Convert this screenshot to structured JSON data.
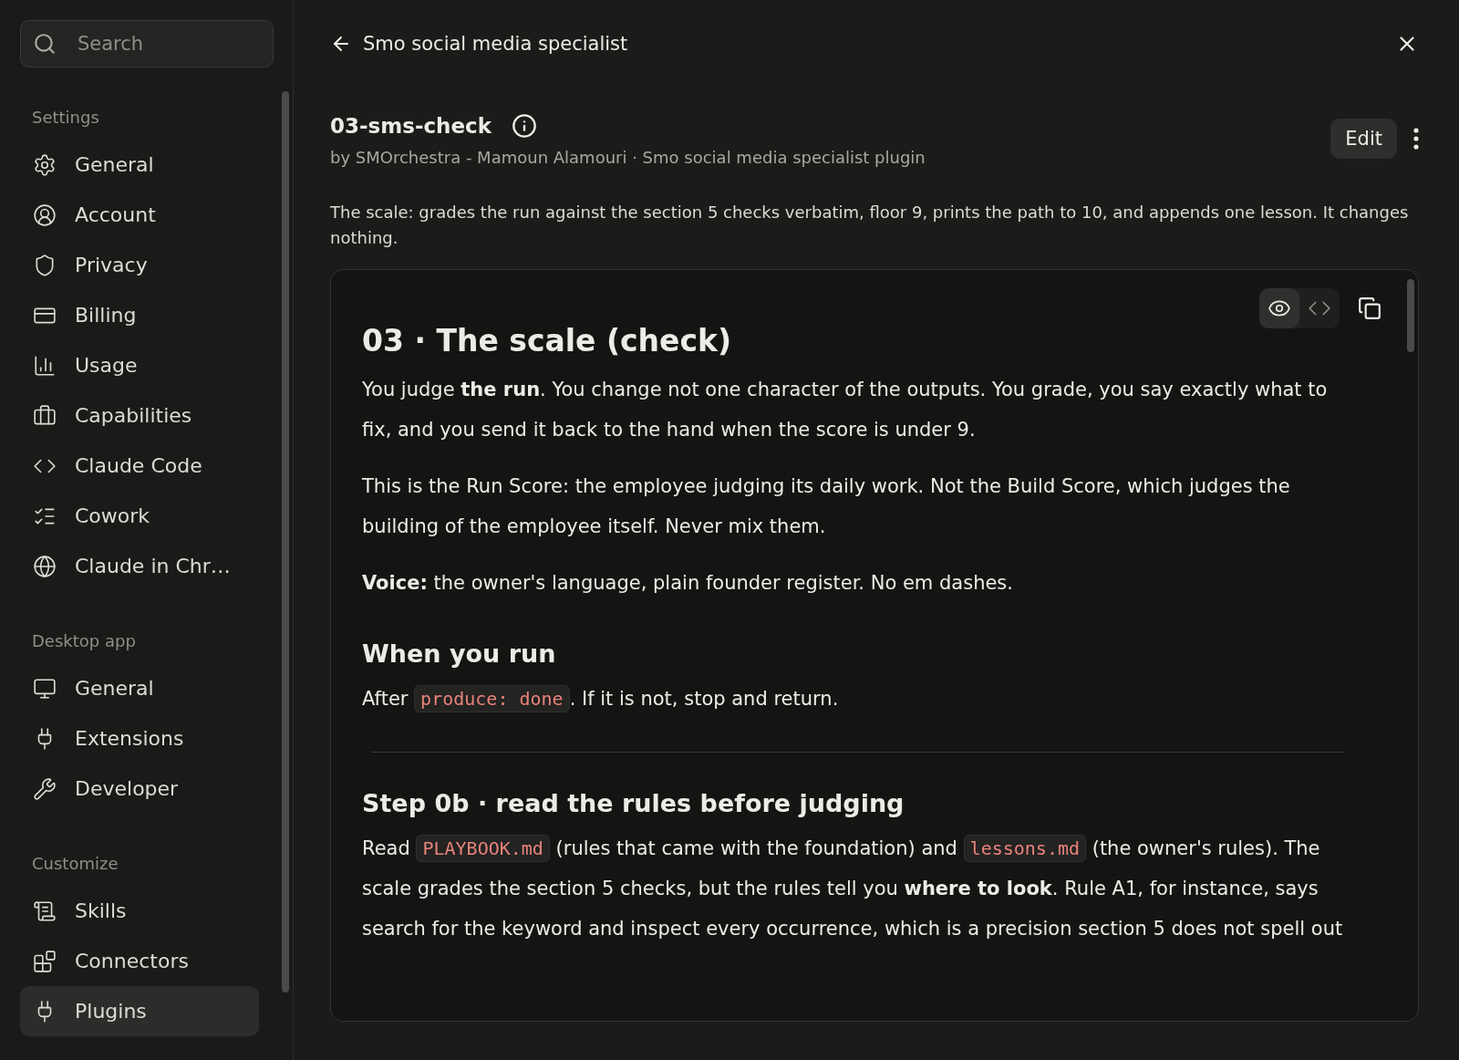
{
  "sidebar": {
    "search": {
      "placeholder": "Search"
    },
    "sections": [
      {
        "title": "Settings",
        "items": [
          {
            "label": "General",
            "selected": false
          },
          {
            "label": "Account",
            "selected": false
          },
          {
            "label": "Privacy",
            "selected": false
          },
          {
            "label": "Billing",
            "selected": false
          },
          {
            "label": "Usage",
            "selected": false
          },
          {
            "label": "Capabilities",
            "selected": false
          },
          {
            "label": "Claude Code",
            "selected": false
          },
          {
            "label": "Cowork",
            "selected": false
          },
          {
            "label": "Claude in Chr…",
            "selected": false
          }
        ]
      },
      {
        "title": "Desktop app",
        "items": [
          {
            "label": "General",
            "selected": false
          },
          {
            "label": "Extensions",
            "selected": false
          },
          {
            "label": "Developer",
            "selected": false
          }
        ]
      },
      {
        "title": "Customize",
        "items": [
          {
            "label": "Skills",
            "selected": false
          },
          {
            "label": "Connectors",
            "selected": false
          },
          {
            "label": "Plugins",
            "selected": true
          }
        ]
      }
    ]
  },
  "header": {
    "title": "Smo social media specialist"
  },
  "skill": {
    "name": "03-sms-check",
    "byline": "by SMOrchestra - Mamoun Alamouri · Smo social media specialist plugin",
    "edit_label": "Edit",
    "description": "The scale: grades the run against the section 5 checks verbatim, floor 9, prints the path to 10, and appends one lesson. It changes nothing."
  },
  "viewer": {
    "modes": [
      {
        "kind": "preview",
        "selected": true
      },
      {
        "kind": "code",
        "selected": false
      }
    ],
    "blocks": [
      {
        "kind": "h1",
        "parts": [
          {
            "kind": "text",
            "text": "03 · The scale (check)"
          }
        ]
      },
      {
        "kind": "p",
        "parts": [
          {
            "kind": "text",
            "text": "You judge **the run**. You change not one character of the outputs. You grade, you say exactly what to fix, and you send it back to the hand when the score is under 9."
          }
        ]
      },
      {
        "kind": "p",
        "parts": [
          {
            "kind": "text",
            "text": "This is the Run Score: the employee judging its daily work. Not the Build Score, which judges the building of the employee itself. Never mix them."
          }
        ]
      },
      {
        "kind": "p",
        "parts": [
          {
            "kind": "text",
            "text": "**Voice:** the owner's language, plain founder register. No em dashes."
          }
        ]
      },
      {
        "kind": "h2",
        "parts": [
          {
            "kind": "text",
            "text": "When you run"
          }
        ]
      },
      {
        "kind": "p",
        "parts": [
          {
            "kind": "text",
            "text": "After "
          },
          {
            "kind": "code",
            "text": "produce: done"
          },
          {
            "kind": "text",
            "text": ". If it is not, stop and return."
          }
        ]
      },
      {
        "kind": "hr"
      },
      {
        "kind": "h2",
        "parts": [
          {
            "kind": "text",
            "text": "Step 0b · read the rules before judging"
          }
        ]
      },
      {
        "kind": "p",
        "parts": [
          {
            "kind": "text",
            "text": "Read "
          },
          {
            "kind": "code",
            "text": "PLAYBOOK.md"
          },
          {
            "kind": "text",
            "text": " (rules that came with the foundation) and "
          },
          {
            "kind": "code",
            "text": "lessons.md"
          },
          {
            "kind": "text",
            "text": " (the owner's rules). The scale grades the section 5 checks, but the rules tell you **where to look**. Rule A1, for instance, says search for the keyword and inspect every occurrence, which is a precision section 5 does not spell out"
          }
        ]
      }
    ]
  }
}
